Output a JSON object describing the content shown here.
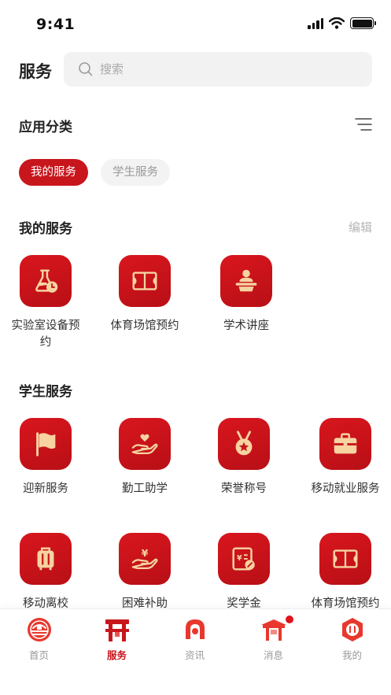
{
  "status_bar": {
    "time": "9:41"
  },
  "header": {
    "title": "服务",
    "search_placeholder": "搜索"
  },
  "category": {
    "title": "应用分类"
  },
  "tabs": [
    {
      "label": "我的服务",
      "active": true
    },
    {
      "label": "学生服务",
      "active": false
    }
  ],
  "my_services": {
    "title": "我的服务",
    "edit_label": "编辑",
    "items": [
      {
        "label": "实验室设备预约",
        "icon": "flask-clock-icon"
      },
      {
        "label": "体育场馆预约",
        "icon": "court-icon"
      },
      {
        "label": "学术讲座",
        "icon": "lecturer-podium-icon"
      }
    ]
  },
  "student_services": {
    "title": "学生服务",
    "items": [
      {
        "label": "迎新服务",
        "icon": "flag-icon"
      },
      {
        "label": "勤工助学",
        "icon": "hand-heart-icon"
      },
      {
        "label": "荣誉称号",
        "icon": "medal-icon"
      },
      {
        "label": "移动就业服务",
        "icon": "briefcase-icon"
      },
      {
        "label": "移动离校",
        "icon": "luggage-icon"
      },
      {
        "label": "困难补助",
        "icon": "hand-yuan-icon"
      },
      {
        "label": "奖学金",
        "icon": "scholarship-card-icon"
      },
      {
        "label": "体育场馆预约",
        "icon": "court-icon"
      }
    ]
  },
  "tabbar": [
    {
      "label": "首页",
      "icon": "home-emblem-icon",
      "active": false
    },
    {
      "label": "服务",
      "icon": "service-gate-icon",
      "active": true
    },
    {
      "label": "资讯",
      "icon": "news-knot-icon",
      "active": false
    },
    {
      "label": "消息",
      "icon": "message-pavilion-icon",
      "active": false,
      "badge": true
    },
    {
      "label": "我的",
      "icon": "profile-emblem-icon",
      "active": false
    }
  ],
  "colors": {
    "primary": "#c8161d",
    "icon_fg": "#f6d3a0",
    "muted": "#999999"
  }
}
